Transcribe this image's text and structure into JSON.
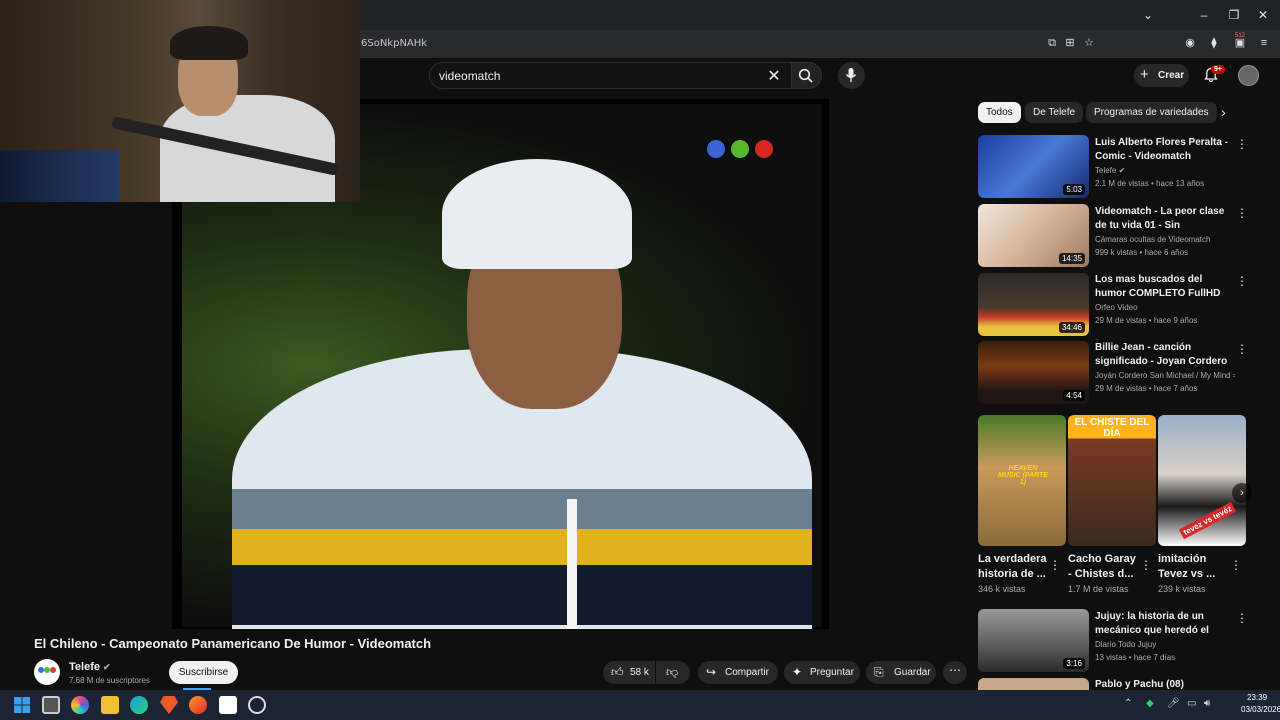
{
  "browser": {
    "url_fragment": "6SoNkpNAHk",
    "window_controls": [
      "chevron-down",
      "minimize",
      "restore",
      "close"
    ],
    "toolbar_badge": "512"
  },
  "header": {
    "search": {
      "value": "videomatch"
    },
    "create_label": "Crear",
    "notifications_badge": "9+"
  },
  "video": {
    "title": "El Chileno - Campeonato Panamericano De Humor - Videomatch",
    "channel": {
      "name": "Telefe",
      "subscribers": "7.68 M de suscriptores",
      "logo_colors": [
        "#3a6fd8",
        "#4fc14a",
        "#e03a3a"
      ]
    },
    "subscribe_label": "Suscribirse",
    "likes": "58 k",
    "share_label": "Compartir",
    "ask_label": "Preguntar",
    "save_label": "Guardar",
    "overlay_dots": [
      "#3b64d6",
      "#56b82c",
      "#d6281f"
    ]
  },
  "sidebar": {
    "chips": [
      "Todos",
      "De Telefe",
      "Programas de variedades"
    ],
    "recommendations": [
      {
        "title": "Luis Alberto Flores Peralta - Comic - Videomatch",
        "channel": "Telefe",
        "verified": true,
        "meta": "2.1 M de vistas • hace 13 años",
        "duration": "5:03"
      },
      {
        "title": "Videomatch - La peor clase de tu vida 01 - Sin interrupciones ...",
        "channel": "Cámaras ocultas de Videomatch",
        "verified": false,
        "meta": "999 k vistas • hace 6 años",
        "duration": "14:35"
      },
      {
        "title": "Los mas buscados del humor COMPLETO FullHD Humor ...",
        "channel": "Orfeo Video",
        "verified": false,
        "meta": "29 M de vistas • hace 9 años",
        "duration": "34:46"
      },
      {
        "title": "Billie Jean - canción significado - Joyan Cordero",
        "channel": "Joyán Cordero San Michael / My Mind = ...",
        "verified": false,
        "meta": "29 M de vistas • hace 7 años",
        "duration": "4:54"
      }
    ],
    "shorts": [
      {
        "title": "La verdadera historia de ...",
        "views": "346 k vistas",
        "overlay": "HEAVEN MUSIC (PARTE 1)"
      },
      {
        "title": "Cacho Garay - Chistes d...",
        "views": "1.7 M de vistas",
        "overlay": "EL CHISTE DEL DÍA"
      },
      {
        "title": "imitación Tevez vs ...",
        "views": "239 k vistas",
        "overlay": "tevez vs tevéz"
      }
    ],
    "recommendations_2": [
      {
        "title": "Jujuy: la historia de un mecánico que heredó el taller ...",
        "channel": "Diario Todo Jujuy",
        "meta": "13 vistas • hace 7 días",
        "duration": "3:16"
      },
      {
        "title": "Pablo y Pachu (08)",
        "channel": "",
        "meta": "",
        "duration": ""
      }
    ]
  },
  "taskbar": {
    "time": "23:39",
    "date": "03/03/2026"
  }
}
